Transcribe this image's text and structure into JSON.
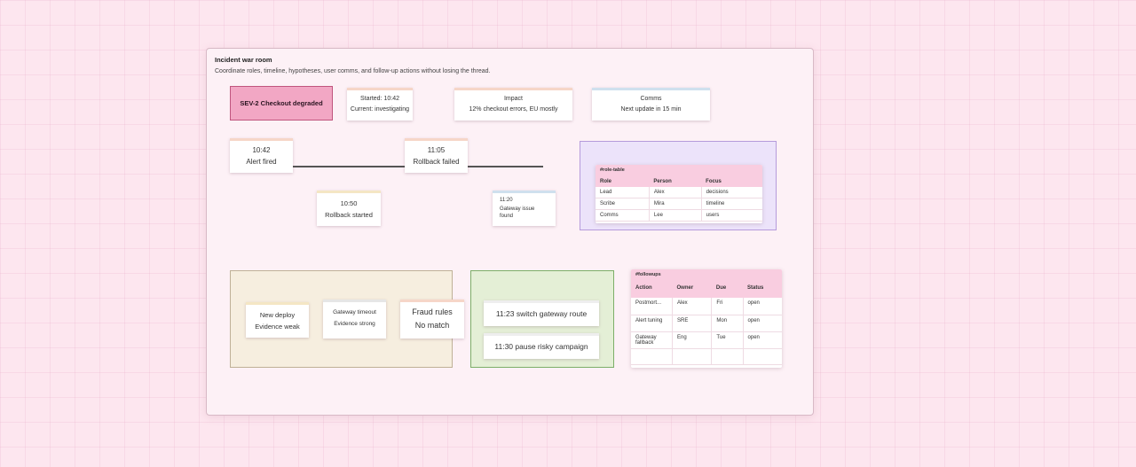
{
  "board": {
    "title": "Incident war room",
    "subtitle": "Coordinate roles, timeline, hypotheses, user comms, and follow-up actions without losing the thread."
  },
  "header_notes": {
    "sev": "SEV-2 Checkout degraded",
    "started": "Started: 10:42",
    "current": "Current: investigating",
    "impact_title": "Impact",
    "impact_text": "12% checkout errors, EU mostly",
    "comms_title": "Comms",
    "comms_text": "Next update in 15 min"
  },
  "timeline": [
    {
      "time": "10:42",
      "label": "Alert fired"
    },
    {
      "time": "11:05",
      "label": "Rollback failed"
    },
    {
      "time": "10:50",
      "label": "Rollback started"
    },
    {
      "time": "11:20",
      "label": "Gateway issue found"
    }
  ],
  "role_table": {
    "name": "#role-table",
    "columns": [
      "Role",
      "Person",
      "Focus"
    ],
    "rows": [
      [
        "Lead",
        "Alex",
        "decisions"
      ],
      [
        "Scribe",
        "Mira",
        "timeline"
      ],
      [
        "Comms",
        "Lee",
        "users"
      ]
    ]
  },
  "hypotheses": {
    "deploy_1": "New deploy",
    "deploy_2": "Evidence weak",
    "gateway_1": "Gateway timeout",
    "gateway_2": "Evidence strong",
    "fraud_1": "Fraud rules",
    "fraud_2": "No match"
  },
  "actions": {
    "a1": "11:23 switch gateway route",
    "a2": "11:30 pause risky campaign"
  },
  "followups": {
    "name": "#followups",
    "columns": [
      "Action",
      "Owner",
      "Due",
      "Status"
    ],
    "rows": [
      [
        "Postmort...",
        "Alex",
        "Fri",
        "open"
      ],
      [
        "Alert tuning",
        "SRE",
        "Mon",
        "open"
      ],
      [
        "Gateway fallback",
        "Eng",
        "Tue",
        "open"
      ],
      [
        "",
        "",
        "",
        ""
      ]
    ]
  },
  "colors": {
    "background": "#fde6ef",
    "sev_fill": "#f2a7c4",
    "table_header": "#f9cde0",
    "role_frame": "#ece3fa",
    "hypothesis_frame": "#f6eedf",
    "action_frame": "#e4efd6"
  }
}
